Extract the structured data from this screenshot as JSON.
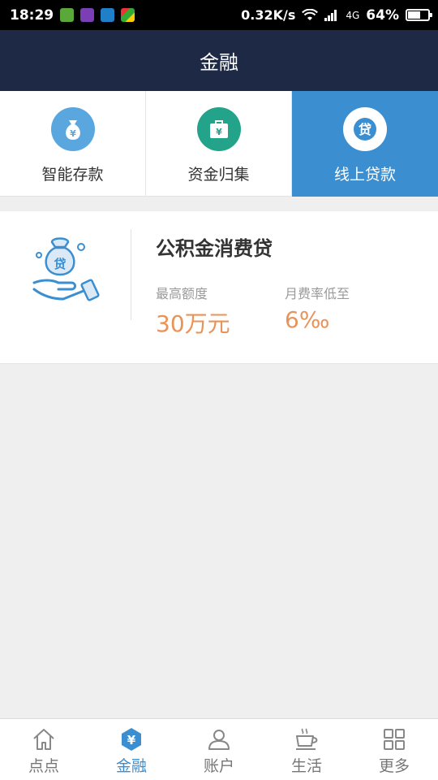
{
  "status_bar": {
    "time": "18:29",
    "net_speed": "0.32K/s",
    "network": "4G",
    "battery": "64%",
    "battery_level": 0.64
  },
  "header": {
    "title": "金融"
  },
  "categories": [
    {
      "label": "智能存款",
      "icon": "money-bag-icon",
      "color": "#5aa7e0",
      "active": false
    },
    {
      "label": "资金归集",
      "icon": "briefcase-yen-icon",
      "color": "#23a38a",
      "active": false
    },
    {
      "label": "线上贷款",
      "icon": "loan-icon",
      "color": "#ffffff",
      "active": true
    }
  ],
  "loan_card": {
    "icon": "hand-money-bag-icon",
    "title": "公积金消费贷",
    "max_label": "最高额度",
    "max_value": "30万元",
    "rate_label": "月费率低至",
    "rate_value": "6‰"
  },
  "bottom_nav": [
    {
      "label": "点点",
      "icon": "home-icon",
      "active": false
    },
    {
      "label": "金融",
      "icon": "finance-hex-icon",
      "active": true
    },
    {
      "label": "账户",
      "icon": "user-icon",
      "active": false
    },
    {
      "label": "生活",
      "icon": "coffee-cup-icon",
      "active": false
    },
    {
      "label": "更多",
      "icon": "grid-icon",
      "active": false
    }
  ],
  "colors": {
    "header_bg": "#1e2a45",
    "accent": "#3b8fd0",
    "highlight": "#e8935a"
  }
}
